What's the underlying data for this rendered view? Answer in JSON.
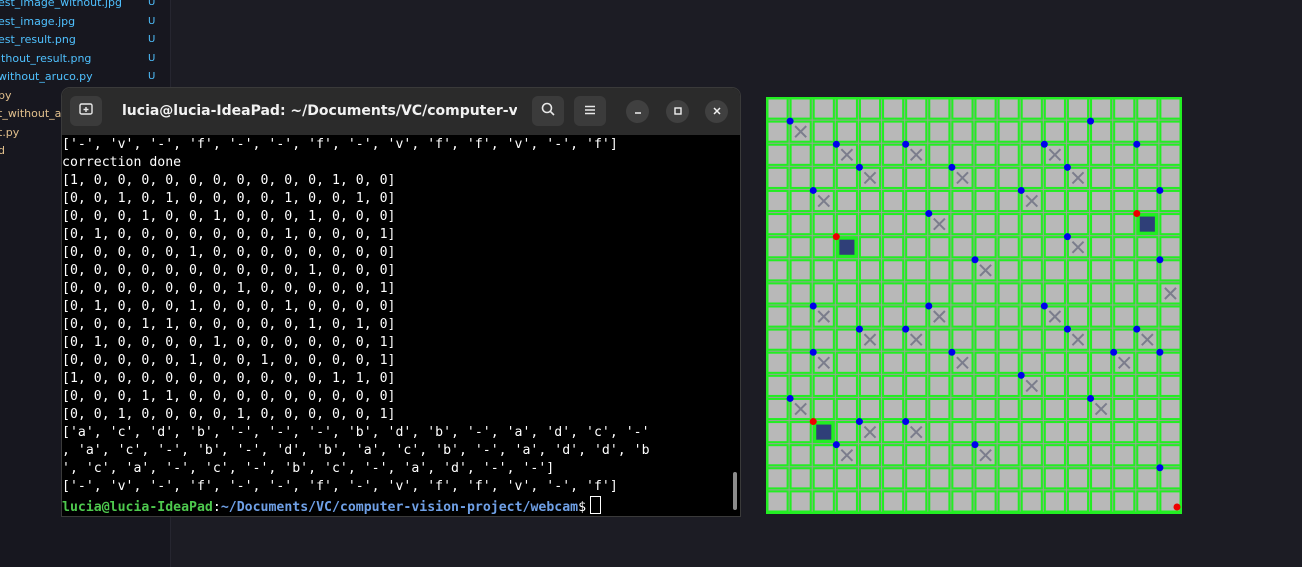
{
  "sidebar": {
    "items": [
      {
        "name": "est_image_without.jpg",
        "badge": "U",
        "color": "#4fc1ff"
      },
      {
        "name": "est_image.jpg",
        "badge": "U",
        "color": "#4fc1ff"
      },
      {
        "name": "est_result.png",
        "badge": "U",
        "color": "#4fc1ff"
      },
      {
        "name": "ithout_result.png",
        "badge": "U",
        "color": "#4fc1ff"
      },
      {
        "name": "without_aruco.py",
        "badge": "U",
        "color": "#4fc1ff"
      },
      {
        "name": "py",
        "badge": "",
        "color": "#e2c08d"
      },
      {
        "name": "t_without_a",
        "badge": "",
        "color": "#e2c08d"
      },
      {
        "name": "t.py",
        "badge": "",
        "color": "#e2c08d"
      },
      {
        "name": "d",
        "badge": "",
        "color": "#e2c08d"
      }
    ]
  },
  "terminal": {
    "title": "lucia@lucia-IdeaPad: ~/Documents/VC/computer-vision...",
    "new_tab_icon": "new-tab-icon",
    "search_icon": "search-icon",
    "menu_icon": "hamburger-menu-icon",
    "lines": [
      "['-', 'v', '-', 'f', '-', '-', 'f', '-', 'v', 'f', 'f', 'v', '-', 'f']",
      "correction done",
      "[1, 0, 0, 0, 0, 0, 0, 0, 0, 0, 0, 1, 0, 0]",
      "[0, 0, 1, 0, 1, 0, 0, 0, 0, 1, 0, 0, 1, 0]",
      "[0, 0, 0, 1, 0, 0, 1, 0, 0, 0, 1, 0, 0, 0]",
      "[0, 1, 0, 0, 0, 0, 0, 0, 0, 1, 0, 0, 0, 1]",
      "[0, 0, 0, 0, 0, 1, 0, 0, 0, 0, 0, 0, 0, 0]",
      "[0, 0, 0, 0, 0, 0, 0, 0, 0, 0, 1, 0, 0, 0]",
      "[0, 0, 0, 0, 0, 0, 0, 1, 0, 0, 0, 0, 0, 1]",
      "[0, 1, 0, 0, 0, 1, 0, 0, 0, 1, 0, 0, 0, 0]",
      "[0, 0, 0, 1, 1, 0, 0, 0, 0, 0, 1, 0, 1, 0]",
      "[0, 1, 0, 0, 0, 0, 1, 0, 0, 0, 0, 0, 0, 1]",
      "[0, 0, 0, 0, 0, 1, 0, 0, 1, 0, 0, 0, 0, 1]",
      "[1, 0, 0, 0, 0, 0, 0, 0, 0, 0, 0, 1, 1, 0]",
      "[0, 0, 0, 1, 1, 0, 0, 0, 0, 0, 0, 0, 0, 0]",
      "[0, 0, 1, 0, 0, 0, 0, 1, 0, 0, 0, 0, 0, 1]",
      "['a', 'c', 'd', 'b', '-', '-', '-', 'b', 'd', 'b', '-', 'a', 'd', 'c', '-'",
      ", 'a', 'c', '-', 'b', '-', 'd', 'b', 'a', 'c', 'b', '-', 'a', 'd', 'd', 'b",
      "', 'c', 'a', '-', 'c', '-', 'b', 'c', '-', 'a', 'd', '-', '-']",
      "['-', 'v', '-', 'f', '-', '-', 'f', '-', 'v', 'f', 'f', 'v', '-', 'f']"
    ],
    "prompt": {
      "user": "lucia@lucia-IdeaPad",
      "separator": ":",
      "path": "~/Documents/VC/computer-vision-project/webcam",
      "symbol": "$"
    }
  },
  "result_image": {
    "grid_color": "#22ee22",
    "cell_color": "#b8b8b8",
    "blue_marker_color": "#0000ee",
    "red_marker_color": "#ee0000",
    "aruco_color": "#2f3f78"
  }
}
